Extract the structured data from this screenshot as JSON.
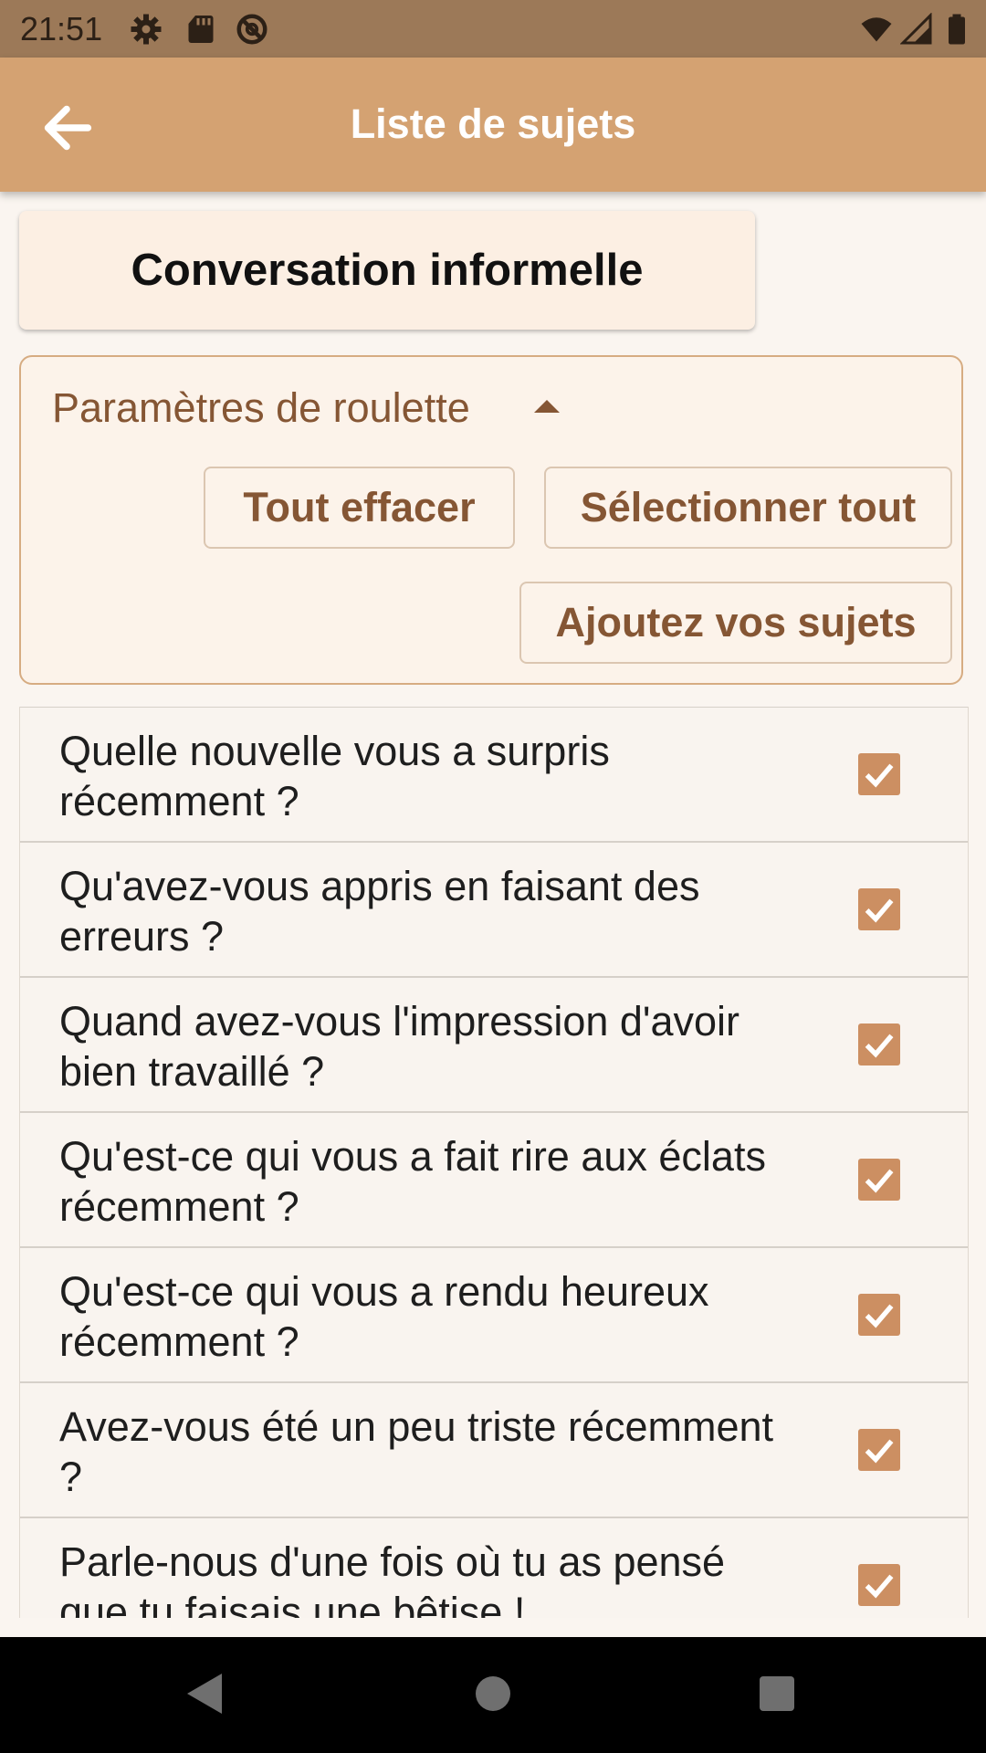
{
  "status_bar": {
    "time": "21:51",
    "left_icons": [
      "gear-icon",
      "sd-card-icon",
      "at-sign-icon"
    ],
    "right_icons": [
      "wifi-icon",
      "cell-signal-icon",
      "battery-icon"
    ],
    "background": "#9c7958"
  },
  "app_bar": {
    "title": "Liste de sujets",
    "back_icon": "arrow-left-icon",
    "background": "#d4a272"
  },
  "category_title": "Conversation informelle",
  "settings": {
    "header": "Paramètres de roulette",
    "collapse_icon": "caret-up-icon",
    "clear_all_label": "Tout effacer",
    "select_all_label": "Sélectionner tout",
    "add_topics_label": "Ajoutez vos sujets"
  },
  "topics": [
    {
      "text": "Quelle nouvelle vous a surpris récemment ?",
      "checked": true
    },
    {
      "text": "Qu'avez-vous appris en faisant des erreurs ?",
      "checked": true
    },
    {
      "text": "Quand avez-vous l'impression d'avoir bien travaillé ?",
      "checked": true
    },
    {
      "text": "Qu'est-ce qui vous a fait rire aux éclats récemment ?",
      "checked": true
    },
    {
      "text": "Qu'est-ce qui vous a rendu heureux récemment ?",
      "checked": true
    },
    {
      "text": "Avez-vous été un peu triste récemment ?",
      "checked": true
    },
    {
      "text": "Parle-nous d'une fois où tu as pensé que tu faisais une bêtise !",
      "checked": true
    }
  ],
  "nav_bar": {
    "icons": [
      "back-triangle-icon",
      "home-circle-icon",
      "recents-square-icon"
    ]
  },
  "colors": {
    "accent": "#d4a272",
    "checkbox": "#cc8f62",
    "button_text": "#855634"
  }
}
